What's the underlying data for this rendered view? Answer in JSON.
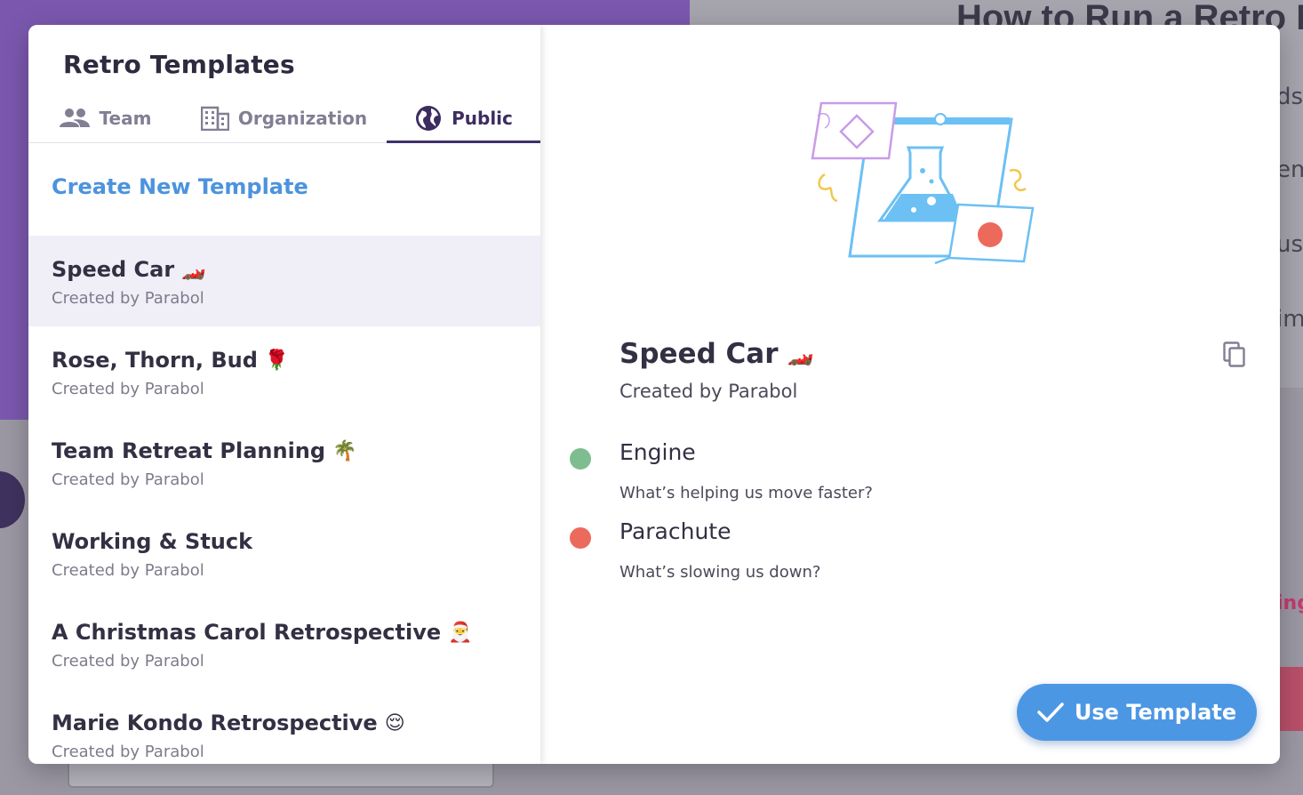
{
  "background": {
    "heading": "How to Run a Retro Me",
    "fragments": [
      "ds",
      "em",
      "uss",
      "im",
      "ing"
    ]
  },
  "modal": {
    "title": "Retro Templates",
    "tabs": [
      {
        "label": "Team",
        "icon": "team-icon"
      },
      {
        "label": "Organization",
        "icon": "organization-icon"
      },
      {
        "label": "Public",
        "icon": "globe-icon",
        "active": true
      }
    ],
    "create_label": "Create New Template",
    "templates": [
      {
        "name": "Speed Car",
        "emoji": "🏎️",
        "subtitle": "Created by Parabol",
        "selected": true
      },
      {
        "name": "Rose, Thorn, Bud",
        "emoji": "🌹",
        "subtitle": "Created by Parabol"
      },
      {
        "name": "Team Retreat Planning",
        "emoji": "🌴",
        "subtitle": "Created by Parabol"
      },
      {
        "name": "Working & Stuck",
        "emoji": "",
        "subtitle": "Created by Parabol"
      },
      {
        "name": "A Christmas Carol Retrospective",
        "emoji": "🎅",
        "subtitle": "Created by Parabol"
      },
      {
        "name": "Marie Kondo Retrospective",
        "emoji": "😌",
        "subtitle": "Created by Parabol"
      }
    ]
  },
  "detail": {
    "title": "Speed Car",
    "emoji": "🏎️",
    "subtitle": "Created by Parabol",
    "prompts": [
      {
        "name": "Engine",
        "description": "What’s helping us move faster?",
        "color": "#7ebd8f"
      },
      {
        "name": "Parachute",
        "description": "What’s slowing us down?",
        "color": "#ec6a5c"
      }
    ],
    "use_button": "Use Template"
  },
  "colors": {
    "accent_blue": "#4c97e4",
    "tab_active": "#40326b",
    "brand_purple": "#7b58ae"
  }
}
